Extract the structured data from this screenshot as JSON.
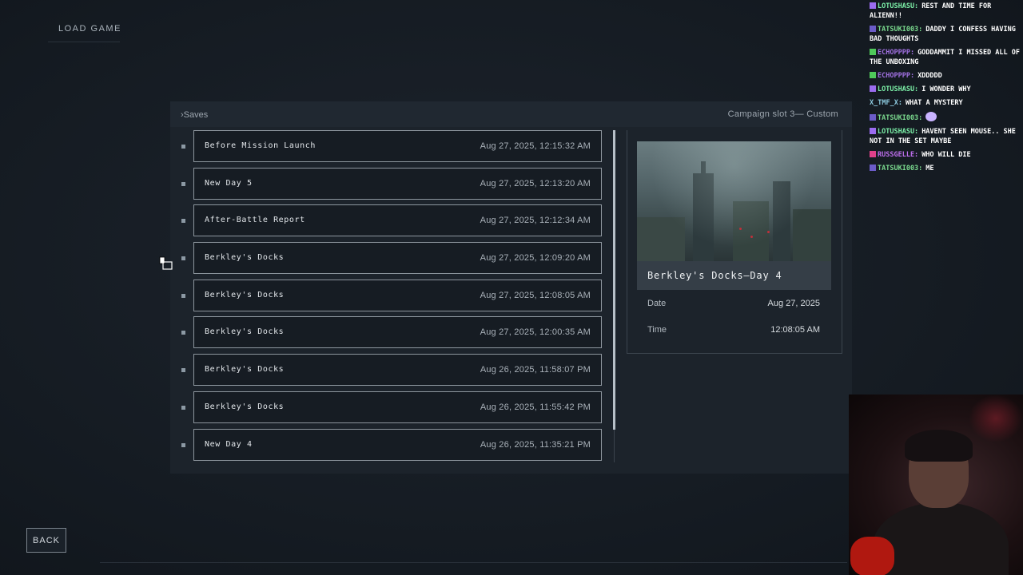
{
  "header": {
    "title": "LOAD GAME"
  },
  "panel": {
    "breadcrumb": "›Saves",
    "slot": "Campaign slot 3— Custom"
  },
  "saves": [
    {
      "name": "Before Mission Launch",
      "date": "Aug 27, 2025, 12:15:32 AM"
    },
    {
      "name": "New Day 5",
      "date": "Aug 27, 2025, 12:13:20 AM"
    },
    {
      "name": "After-Battle Report",
      "date": "Aug 27, 2025, 12:12:34 AM"
    },
    {
      "name": "Berkley's Docks",
      "date": "Aug 27, 2025, 12:09:20 AM"
    },
    {
      "name": "Berkley's Docks",
      "date": "Aug 27, 2025, 12:08:05 AM"
    },
    {
      "name": "Berkley's Docks",
      "date": "Aug 27, 2025, 12:00:35 AM"
    },
    {
      "name": "Berkley's Docks",
      "date": "Aug 26, 2025, 11:58:07 PM"
    },
    {
      "name": "Berkley's Docks",
      "date": "Aug 26, 2025, 11:55:42 PM"
    },
    {
      "name": "New Day 4",
      "date": "Aug 26, 2025, 11:35:21 PM"
    }
  ],
  "detail": {
    "title": "Berkley's Docks—Day 4",
    "date_label": "Date",
    "date_value": "Aug 27, 2025",
    "time_label": "Time",
    "time_value": "12:08:05 AM"
  },
  "footer": {
    "back_label": "BACK"
  },
  "colors": {
    "background": "#161c24",
    "panel": "#1c232b",
    "border": "#8d969e",
    "accent": "#b7c0c8"
  },
  "chat": [
    {
      "user": "LOTUSHASU:",
      "color": "#7cf0a8",
      "badge": "#9b6cf0",
      "msg": "REST AND TIME FOR ALIENN!!"
    },
    {
      "user": "TATSUKI003:",
      "color": "#7ad98e",
      "badge": "#6b5cc8",
      "msg": "DADDY I CONFESS HAVING BAD THOUGHTS"
    },
    {
      "user": "ECHOPPPP:",
      "color": "#a070e0",
      "badge": "#4fc85a",
      "msg": "GODDAMMIT I MISSED ALL OF THE UNBOXING"
    },
    {
      "user": "ECHOPPPP:",
      "color": "#a070e0",
      "badge": "#4fc85a",
      "msg": "XDDDDD"
    },
    {
      "user": "LOTUSHASU:",
      "color": "#7cf0a8",
      "badge": "#9b6cf0",
      "msg": "I WONDER WHY"
    },
    {
      "user": "X_TMF_X:",
      "color": "#8ecbe0",
      "badge": "",
      "msg": "WHAT A MYSTERY"
    },
    {
      "user": "TATSUKI003:",
      "color": "#7ad98e",
      "badge": "#6b5cc8",
      "msg": ""
    },
    {
      "user": "LOTUSHASU:",
      "color": "#7cf0a8",
      "badge": "#9b6cf0",
      "msg": "HAVENT SEEN MOUSE.. SHE NOT IN THE SET MAYBE"
    },
    {
      "user": "RUSSGELLE:",
      "color": "#c070f0",
      "badge": "#e0408a",
      "msg": "WHO WILL DIE"
    },
    {
      "user": "TATSUKI003:",
      "color": "#7ad98e",
      "badge": "#6b5cc8",
      "msg": "ME"
    }
  ]
}
